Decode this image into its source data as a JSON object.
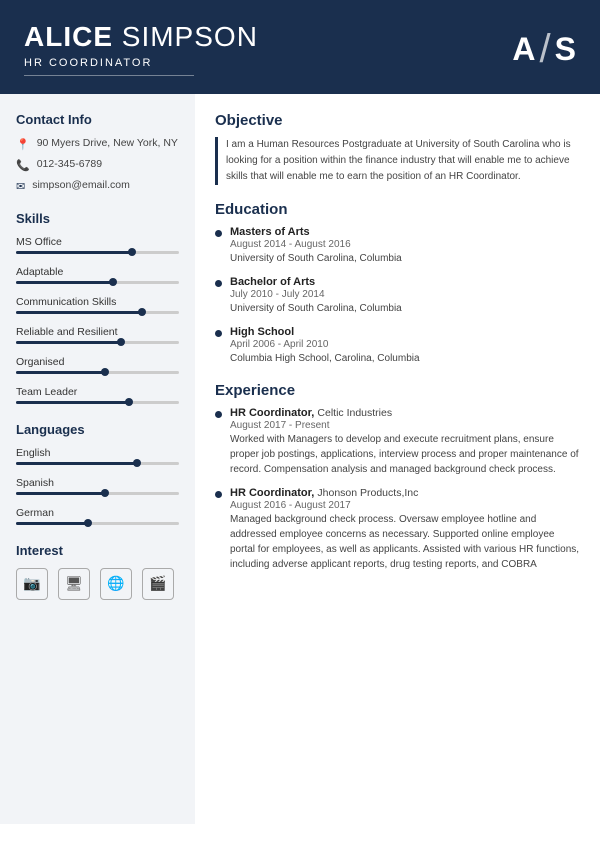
{
  "header": {
    "first_name": "ALICE",
    "last_name": "SIMPSON",
    "title": "HR COORDINATOR",
    "monogram_top": "A",
    "monogram_slash": "/",
    "monogram_bottom": "S"
  },
  "sidebar": {
    "contact_title": "Contact Info",
    "contact": {
      "address": "90 Myers Drive, New York, NY",
      "phone": "012-345-6789",
      "email": "simpson@email.com"
    },
    "skills_title": "Skills",
    "skills": [
      {
        "label": "MS Office",
        "percent": 72
      },
      {
        "label": "Adaptable",
        "percent": 60
      },
      {
        "label": "Communication Skills",
        "percent": 78
      },
      {
        "label": "Reliable and Resilient",
        "percent": 65
      },
      {
        "label": "Organised",
        "percent": 55
      },
      {
        "label": "Team Leader",
        "percent": 70
      }
    ],
    "languages_title": "Languages",
    "languages": [
      {
        "label": "English",
        "percent": 75
      },
      {
        "label": "Spanish",
        "percent": 55
      },
      {
        "label": "German",
        "percent": 45
      }
    ],
    "interest_title": "Interest",
    "interests": [
      "📷",
      "🖥",
      "🌐",
      "🎬"
    ]
  },
  "main": {
    "objective_title": "Objective",
    "objective_text": "I am a Human Resources Postgraduate at University of South Carolina who is looking for a position within the finance industry that will enable me to achieve skills that will enable me to earn the position of an HR Coordinator.",
    "education_title": "Education",
    "education": [
      {
        "degree": "Masters of Arts",
        "dates": "August 2014 - August 2016",
        "school": "University of South Carolina, Columbia"
      },
      {
        "degree": "Bachelor of Arts",
        "dates": "July 2010 - July 2014",
        "school": "University of South Carolina, Columbia"
      },
      {
        "degree": "High School",
        "dates": "April 2006 - April 2010",
        "school": "Columbia High School, Carolina, Columbia"
      }
    ],
    "experience_title": "Experience",
    "experience": [
      {
        "title": "HR Coordinator",
        "company": "Celtic Industries",
        "dates": "August 2017 - Present",
        "desc": "Worked with Managers to develop and execute recruitment plans, ensure proper job postings, applications, interview process and proper maintenance of record. Compensation analysis and managed background check process."
      },
      {
        "title": "HR Coordinator",
        "company": "Jhonson Products,Inc",
        "dates": "August 2016 - August 2017",
        "desc": "Managed background check process. Oversaw employee hotline and addressed employee concerns as necessary. Supported online employee portal for employees, as well as applicants. Assisted with various HR functions, including adverse applicant reports, drug testing reports, and COBRA"
      }
    ]
  }
}
